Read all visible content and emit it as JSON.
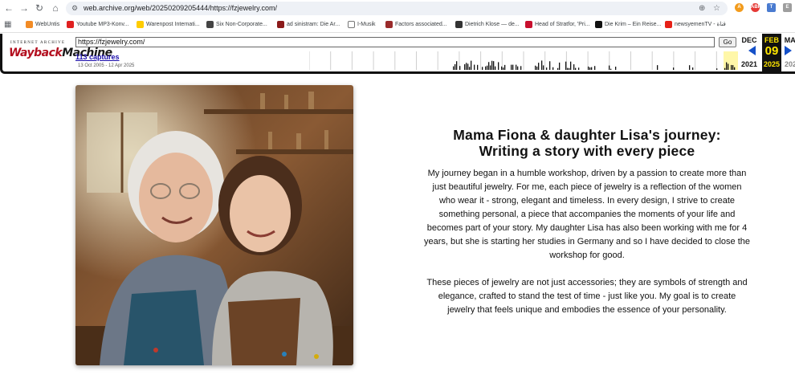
{
  "browser": {
    "url": "web.archive.org/web/20250209205444/https://fzjewelry.com/",
    "bookmarks": [
      {
        "label": "WebUntis",
        "color": "#f28b25"
      },
      {
        "label": "Youtube MP3-Konv...",
        "color": "#e02020"
      },
      {
        "label": "Warenpost Internati...",
        "color": "#ffcc00"
      },
      {
        "label": "Six Non-Corporate...",
        "color": "#444444"
      },
      {
        "label": "ad sinistram: Die Ar...",
        "color": "#8b1a1a"
      },
      {
        "label": "I-Musik",
        "color": "#888888"
      },
      {
        "label": "Factors associated...",
        "color": "#9a2b2b"
      },
      {
        "label": "Dietrich Klose — de...",
        "color": "#333333"
      },
      {
        "label": "Head of Stratfor, 'Pri...",
        "color": "#c8102e"
      },
      {
        "label": "Die Krim – Ein Reise...",
        "color": "#111111"
      },
      {
        "label": "newsyemenTV - قناة",
        "color": "#e62117"
      }
    ]
  },
  "wayback": {
    "logo_top": "INTERNET ARCHIVE",
    "logo_part1": "Wayback",
    "logo_part2": "Machine",
    "url_value": "https://fzjewelry.com/",
    "go_label": "Go",
    "captures_label": "113 captures",
    "range_label": "13 Oct 2005 - 12 Apr 2025",
    "prev_month": "DEC",
    "prev_year": "2021",
    "cur_month": "FEB",
    "cur_day": "09",
    "cur_year": "2025",
    "next_month": "MAR",
    "next_year": "2026"
  },
  "page": {
    "title_line1": "Mama Fiona & daughter Lisa's journey:",
    "title_line2": "Writing a story with every piece",
    "paragraph1": "My journey began in a humble workshop, driven by a passion to create more than just beautiful jewelry. For me, each piece of jewelry is a reflection of the women who wear it - strong, elegant and timeless. In every design, I strive to create something personal, a piece that accompanies the moments of your life and becomes part of your story. My daughter Lisa has also been working with me for 4 years, but she is starting her studies in Germany and so I have decided to close the workshop for good.",
    "paragraph2": "These pieces of jewelry are not just accessories; they are symbols of strength and elegance, crafted to stand the test of time - just like you. My goal is to create jewelry that feels unique and embodies the essence of your personality."
  },
  "colors": {
    "wayback_red": "#b30f1f",
    "highlight_yellow": "#ffe600",
    "link_blue": "#1a0dab"
  }
}
